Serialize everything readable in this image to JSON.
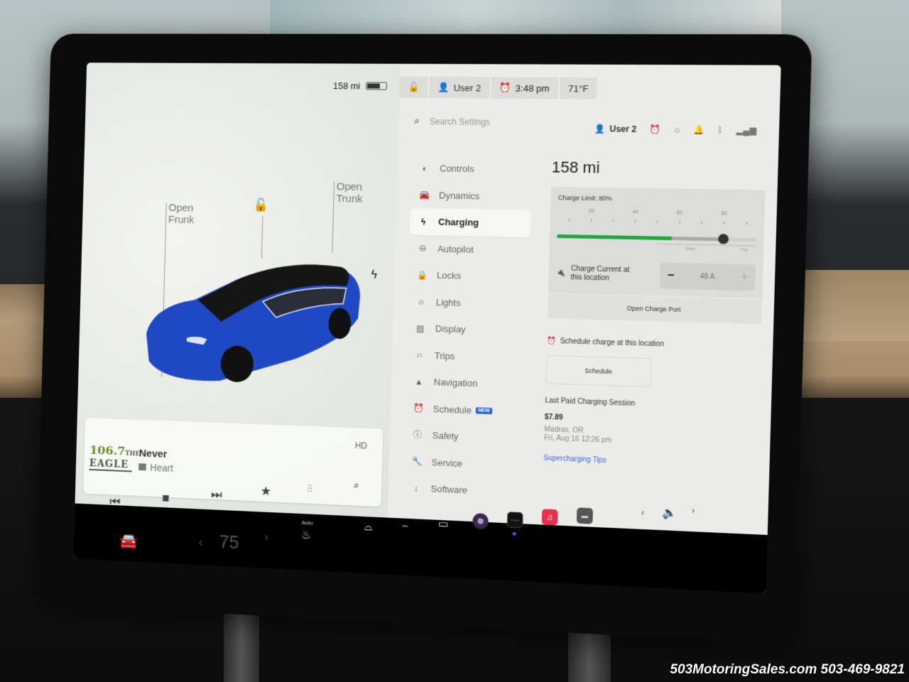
{
  "watermark": "503MotoringSales.com 503-469-9821",
  "status_bar": {
    "range": "158 mi",
    "battery_level_fraction": 0.65,
    "user": "User 2",
    "time": "3:48 pm",
    "temperature": "71°F"
  },
  "car_panel": {
    "frunk_label_line1": "Open",
    "frunk_label_line2": "Frunk",
    "trunk_label_line1": "Open",
    "trunk_label_line2": "Trunk",
    "car_color": "#1f49c4"
  },
  "media": {
    "station_number": "106.7",
    "station_the": "THE",
    "station_name": "EAGLE",
    "song_title": "Never",
    "artist": "Heart",
    "hd_label": "HD"
  },
  "settings": {
    "search_placeholder": "Search Settings",
    "header_user": "User 2",
    "nav_items": [
      {
        "label": "Controls",
        "icon": "toggle-icon",
        "glyph": "◐"
      },
      {
        "label": "Dynamics",
        "icon": "car-icon",
        "glyph": "🚘"
      },
      {
        "label": "Charging",
        "icon": "bolt-icon",
        "glyph": "ϟ",
        "active": true
      },
      {
        "label": "Autopilot",
        "icon": "steering-wheel-icon",
        "glyph": "⊖"
      },
      {
        "label": "Locks",
        "icon": "lock-icon",
        "glyph": "🔒"
      },
      {
        "label": "Lights",
        "icon": "sun-icon",
        "glyph": "☼"
      },
      {
        "label": "Display",
        "icon": "display-icon",
        "glyph": "▨"
      },
      {
        "label": "Trips",
        "icon": "trips-icon",
        "glyph": "∩"
      },
      {
        "label": "Navigation",
        "icon": "navigation-arrow-icon",
        "glyph": "▲"
      },
      {
        "label": "Schedule",
        "icon": "alarm-clock-icon",
        "glyph": "⏰",
        "badge": "NEW"
      },
      {
        "label": "Safety",
        "icon": "safety-icon",
        "glyph": "ⓘ"
      },
      {
        "label": "Service",
        "icon": "wrench-icon",
        "glyph": "🔧"
      },
      {
        "label": "Software",
        "icon": "download-icon",
        "glyph": "↓"
      }
    ]
  },
  "charging": {
    "range": "158 mi",
    "charge_limit_label": "Charge Limit: 80%",
    "charge_limit_percent": 80,
    "current_charge_percent": 57,
    "available_energy_percent": 80,
    "tick_labels": [
      "20",
      "40",
      "60",
      "80"
    ],
    "daily_label": "Daily",
    "trip_label": "Trip",
    "charge_current_label_line1": "Charge Current at",
    "charge_current_label_line2": "this location",
    "charge_current_value": "48 A",
    "minus_label": "−",
    "plus_label": "+",
    "open_charge_port_label": "Open Charge Port",
    "schedule_text": "Schedule charge at this location",
    "schedule_button_label": "Schedule",
    "last_session_title": "Last Paid Charging Session",
    "last_session_price": "$7.89",
    "last_session_location": "Madras, OR",
    "last_session_date": "Fri, Aug 16 12:26 pm",
    "supercharging_tips_label": "Supercharging Tips",
    "accent_green": "#1fa83f",
    "link_blue": "#3d6ad6"
  },
  "bottom_bar": {
    "cabin_temp": "75",
    "seat_heat_label": "Auto"
  }
}
